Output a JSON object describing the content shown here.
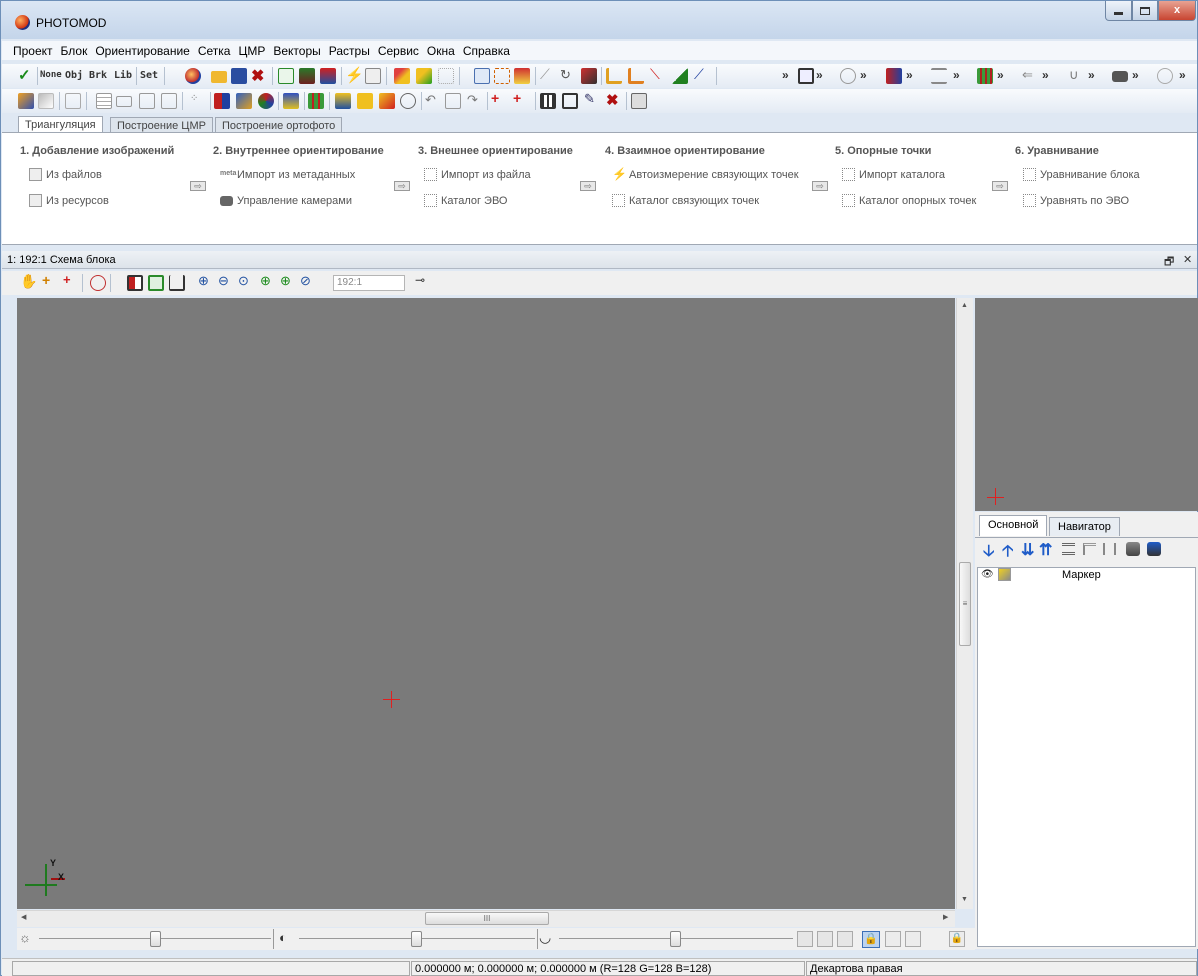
{
  "window": {
    "title": "PHOTOMOD",
    "minimize_icon": "minimize-icon",
    "maximize_icon": "maximize-icon",
    "close_label": "x"
  },
  "menu": [
    "Проект",
    "Блок",
    "Ориентирование",
    "Сетка",
    "ЦМР",
    "Векторы",
    "Растры",
    "Сервис",
    "Окна",
    "Справка"
  ],
  "toolbar": {
    "text_buttons": [
      "None",
      "Obj",
      "Brk",
      "Lib",
      "Set"
    ],
    "overflow": "»"
  },
  "tabs": [
    "Триангуляция",
    "Построение ЦМР",
    "Построение ортофото"
  ],
  "wizard": {
    "steps": [
      {
        "title": "1. Добавление изображений",
        "items": [
          "Из файлов",
          "Из ресурсов"
        ]
      },
      {
        "title": "2. Внутреннее ориентирование",
        "items": [
          "Импорт из метаданных",
          "Управление камерами"
        ]
      },
      {
        "title": "3. Внешнее ориентирование",
        "items": [
          "Импорт из файла",
          "Каталог ЭВО"
        ]
      },
      {
        "title": "4. Взаимное ориентирование",
        "items": [
          "Автоизмерение связующих точек",
          "Каталог связующих точек"
        ]
      },
      {
        "title": "5. Опорные точки",
        "items": [
          "Импорт каталога",
          "Каталог опорных точек"
        ]
      },
      {
        "title": "6. Уравнивание",
        "items": [
          "Уравнивание блока",
          "Уравнять по ЭВО"
        ]
      }
    ],
    "arrow_glyph": "⇨",
    "meta_icon_text": "meta"
  },
  "view": {
    "title": "1: 192:1 Схема блока",
    "zoom_value": "192:1",
    "restore_glyph": "🗗",
    "close_glyph": "✕",
    "axis_y": "Y",
    "axis_x": "X",
    "scroll_grip": "III",
    "vscroll_grip": "≡"
  },
  "panel": {
    "tabs": [
      "Основной",
      "Навигатор"
    ],
    "layers": [
      {
        "name": "Маркер"
      }
    ]
  },
  "status": {
    "left": "",
    "coords": "0.000000 м; 0.000000 м; 0.000000 м   (R=128 G=128 B=128)",
    "system": "Декартова правая"
  },
  "colors": {
    "canvas": "#7a7a7a",
    "marker": "#e02020",
    "axis": "#1f7a1f"
  }
}
